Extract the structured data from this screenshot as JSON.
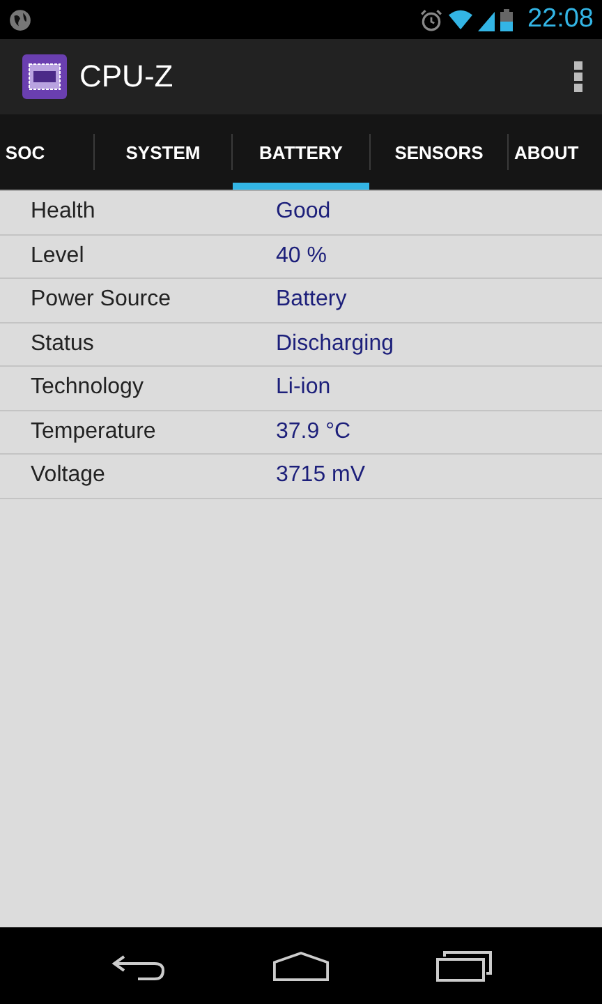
{
  "status_bar": {
    "time": "22:08"
  },
  "app_bar": {
    "title": "CPU-Z"
  },
  "tabs": [
    {
      "label": "SOC",
      "selected": false
    },
    {
      "label": "SYSTEM",
      "selected": false
    },
    {
      "label": "BATTERY",
      "selected": true
    },
    {
      "label": "SENSORS",
      "selected": false
    },
    {
      "label": "ABOUT",
      "selected": false
    }
  ],
  "rows": [
    {
      "label": "Health",
      "value": "Good"
    },
    {
      "label": "Level",
      "value": "40 %"
    },
    {
      "label": "Power Source",
      "value": "Battery"
    },
    {
      "label": "Status",
      "value": "Discharging"
    },
    {
      "label": "Technology",
      "value": "Li-ion"
    },
    {
      "label": "Temperature",
      "value": "37.9 °C"
    },
    {
      "label": "Voltage",
      "value": "3715 mV"
    }
  ]
}
